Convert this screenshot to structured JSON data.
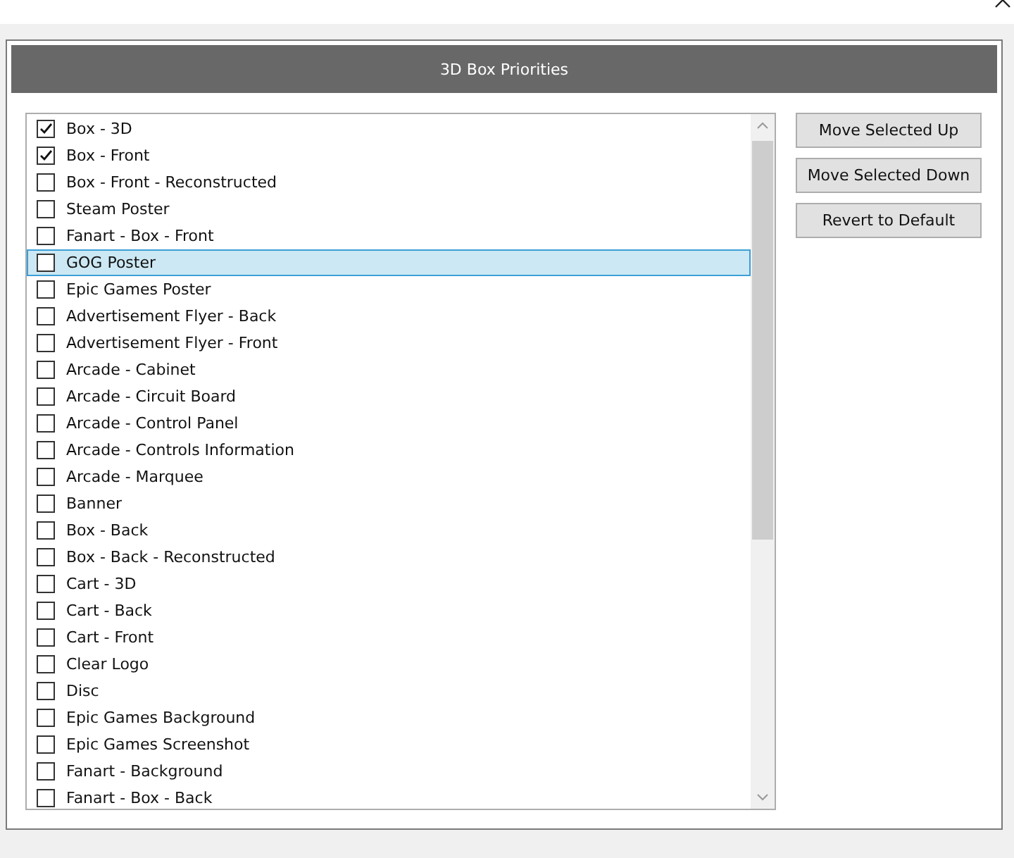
{
  "dialog": {
    "title": "3D Box Priorities"
  },
  "items": [
    {
      "label": "Box - 3D",
      "checked": true,
      "selected": false
    },
    {
      "label": "Box - Front",
      "checked": true,
      "selected": false
    },
    {
      "label": "Box - Front - Reconstructed",
      "checked": false,
      "selected": false
    },
    {
      "label": "Steam Poster",
      "checked": false,
      "selected": false
    },
    {
      "label": "Fanart - Box - Front",
      "checked": false,
      "selected": false
    },
    {
      "label": "GOG Poster",
      "checked": false,
      "selected": true
    },
    {
      "label": "Epic Games Poster",
      "checked": false,
      "selected": false
    },
    {
      "label": "Advertisement Flyer - Back",
      "checked": false,
      "selected": false
    },
    {
      "label": "Advertisement Flyer - Front",
      "checked": false,
      "selected": false
    },
    {
      "label": "Arcade - Cabinet",
      "checked": false,
      "selected": false
    },
    {
      "label": "Arcade - Circuit Board",
      "checked": false,
      "selected": false
    },
    {
      "label": "Arcade - Control Panel",
      "checked": false,
      "selected": false
    },
    {
      "label": "Arcade - Controls Information",
      "checked": false,
      "selected": false
    },
    {
      "label": "Arcade - Marquee",
      "checked": false,
      "selected": false
    },
    {
      "label": "Banner",
      "checked": false,
      "selected": false
    },
    {
      "label": "Box - Back",
      "checked": false,
      "selected": false
    },
    {
      "label": "Box - Back - Reconstructed",
      "checked": false,
      "selected": false
    },
    {
      "label": "Cart - 3D",
      "checked": false,
      "selected": false
    },
    {
      "label": "Cart - Back",
      "checked": false,
      "selected": false
    },
    {
      "label": "Cart - Front",
      "checked": false,
      "selected": false
    },
    {
      "label": "Clear Logo",
      "checked": false,
      "selected": false
    },
    {
      "label": "Disc",
      "checked": false,
      "selected": false
    },
    {
      "label": "Epic Games Background",
      "checked": false,
      "selected": false
    },
    {
      "label": "Epic Games Screenshot",
      "checked": false,
      "selected": false
    },
    {
      "label": "Fanart - Background",
      "checked": false,
      "selected": false
    },
    {
      "label": "Fanart - Box - Back",
      "checked": false,
      "selected": false
    }
  ],
  "buttons": [
    "Move Selected Up",
    "Move Selected Down",
    "Revert to Default"
  ]
}
